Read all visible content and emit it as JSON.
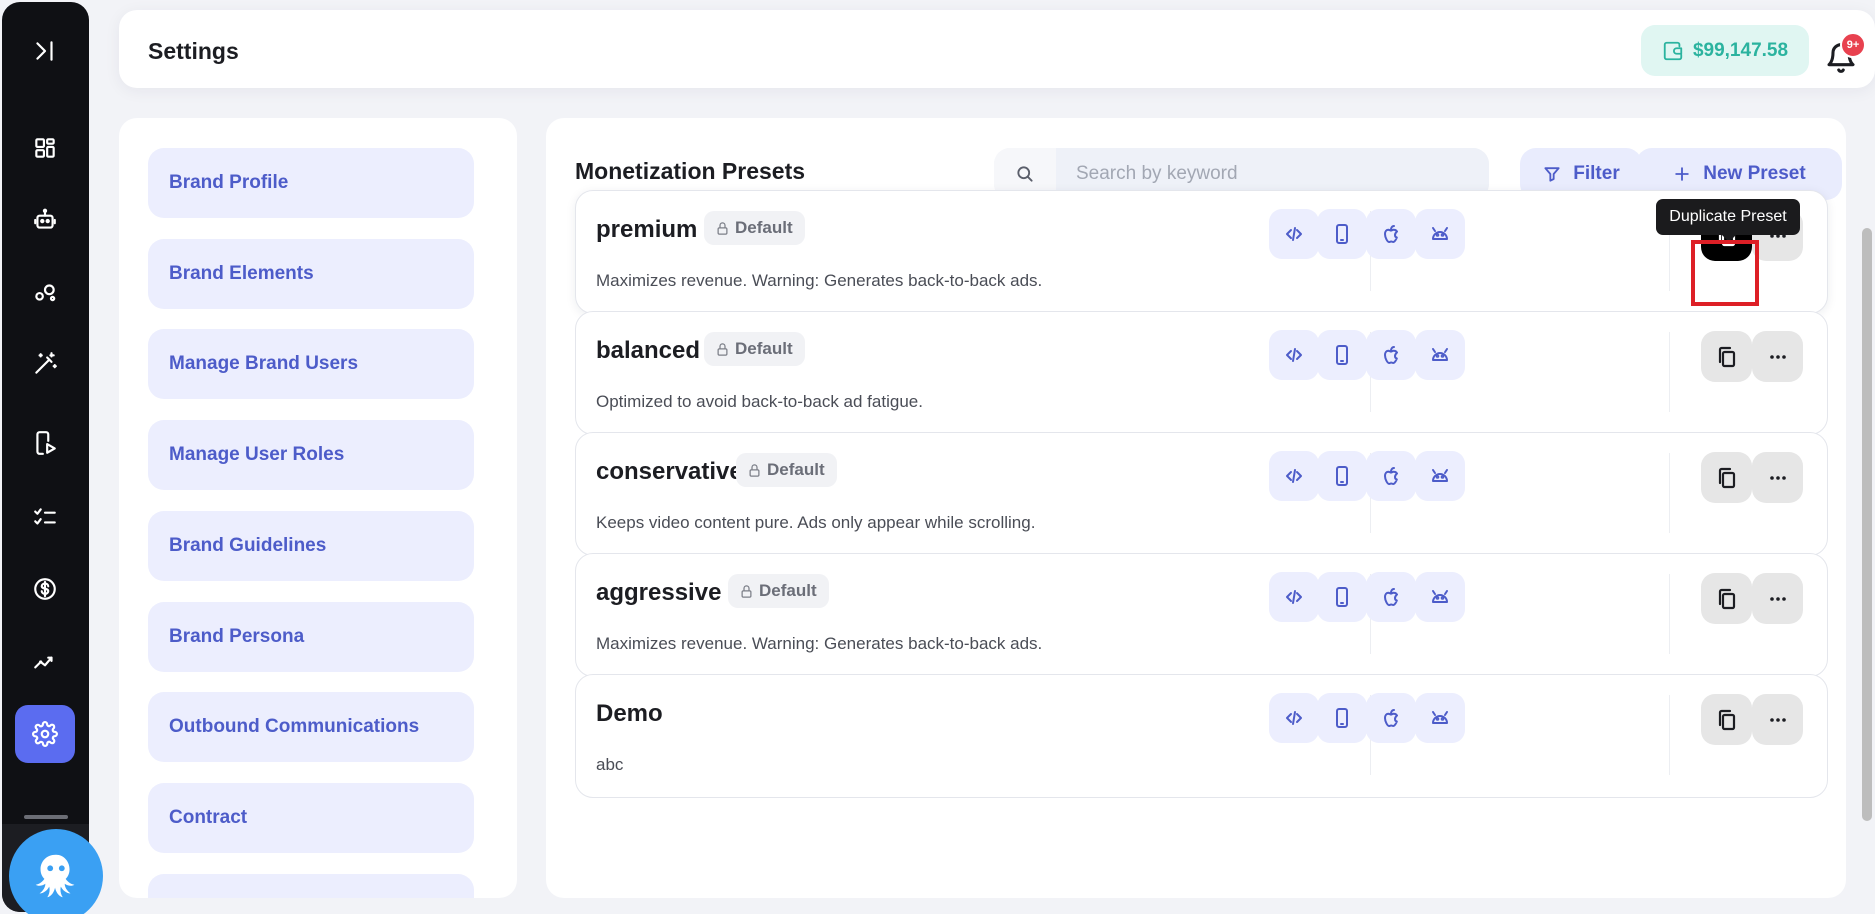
{
  "header": {
    "title": "Settings",
    "balance": "$99,147.58",
    "notification_badge": "9+"
  },
  "rail": {
    "items": [
      {
        "name": "expand-icon"
      },
      {
        "name": "dashboard-icon"
      },
      {
        "name": "robot-icon"
      },
      {
        "name": "circles-icon"
      },
      {
        "name": "magic-wand-icon"
      },
      {
        "name": "video-device-icon"
      },
      {
        "name": "checklist-icon"
      },
      {
        "name": "dollar-icon"
      },
      {
        "name": "analytics-icon"
      },
      {
        "name": "settings-icon",
        "active": true
      }
    ]
  },
  "settings_menu": {
    "items": [
      {
        "label": "Brand Profile"
      },
      {
        "label": "Brand Elements"
      },
      {
        "label": "Manage Brand Users"
      },
      {
        "label": "Manage User Roles"
      },
      {
        "label": "Brand Guidelines"
      },
      {
        "label": "Brand Persona"
      },
      {
        "label": "Outbound Communications"
      },
      {
        "label": "Contract"
      }
    ]
  },
  "main": {
    "title": "Monetization Presets",
    "search": {
      "placeholder": "Search by keyword",
      "value": ""
    },
    "filter_label": "Filter",
    "new_preset_label": "New Preset",
    "tooltip": "Duplicate Preset",
    "presets": [
      {
        "name": "premium",
        "badge": "Default",
        "description": "Maximizes revenue. Warning: Generates back-to-back ads."
      },
      {
        "name": "balanced",
        "badge": "Default",
        "description": "Optimized to avoid back-to-back ad fatigue."
      },
      {
        "name": "conservative",
        "badge": "Default",
        "description": "Keeps video content pure. Ads only appear while scrolling."
      },
      {
        "name": "aggressive",
        "badge": "Default",
        "description": "Maximizes revenue. Warning: Generates back-to-back ads."
      },
      {
        "name": "Demo",
        "badge": "",
        "description": "abc"
      }
    ]
  },
  "colors": {
    "accent": "#5b6cf0",
    "menu_text": "#4d5cc9",
    "menu_bg": "#eceefe",
    "balance_text": "#2bb39f",
    "badge_red": "#e8414f",
    "highlight_red": "#dd1f26"
  }
}
